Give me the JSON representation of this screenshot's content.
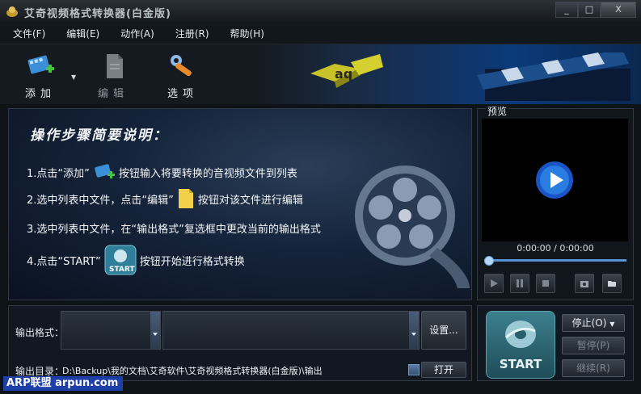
{
  "window": {
    "title": "艾奇视频格式转换器(白金版)",
    "buttons": [
      "_",
      "□",
      "X"
    ]
  },
  "menu": [
    {
      "label": "文件(F)"
    },
    {
      "label": "编辑(E)"
    },
    {
      "label": "动作(A)"
    },
    {
      "label": "注册(R)"
    },
    {
      "label": "帮助(H)"
    }
  ],
  "toolbar": {
    "add_label": "添加",
    "edit_label": "编辑",
    "options_label": "选项",
    "logo_text": "aq"
  },
  "guide": {
    "title": "操作步骤简要说明：",
    "steps": [
      {
        "before": "1.点击“添加”",
        "after": "按钮输入将要转换的音视频文件到列表"
      },
      {
        "before": "2.选中列表中文件，点击“编辑”",
        "after": "按钮对该文件进行编辑"
      },
      {
        "before": "3.选中列表中文件，在“输出格式”复选框中更改当前的输出格式",
        "after": ""
      },
      {
        "before": "4.点击“START”",
        "after": "按钮开始进行格式转换"
      }
    ]
  },
  "preview": {
    "label": "预览",
    "time": "0:00:00 / 0:00:00",
    "position": 0
  },
  "output": {
    "format_label": "输出格式：",
    "settings_button": "设置...",
    "dir_label": "输出目录：",
    "dir_value": "D:\\Backup\\我的文档\\艾奇软件\\艾奇视频格式转换器(白金版)\\输出",
    "open_button": "打开"
  },
  "controls": {
    "start_label": "START",
    "stop_label": "停止(O)",
    "pause_label": "暂停(P)",
    "resume_label": "继续(R)"
  },
  "watermark": "ARP联盟 arpun.com",
  "colors": {
    "accent": "#2a7de0",
    "panel_bg": "#15233a",
    "start": "#3c7f8e"
  }
}
